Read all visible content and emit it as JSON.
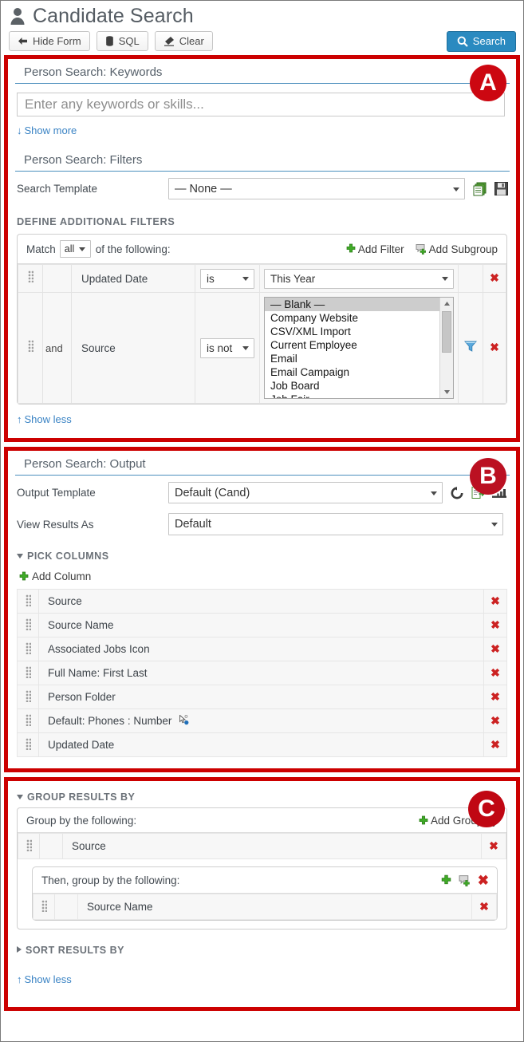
{
  "header": {
    "title": "Candidate Search",
    "person_icon": "person-icon",
    "buttons": {
      "hide_form": "Hide Form",
      "sql": "SQL",
      "clear": "Clear",
      "search": "Search"
    }
  },
  "annotations": {
    "a": "A",
    "b": "B",
    "c": "C"
  },
  "keywords": {
    "section_title": "Person Search: Keywords",
    "input_value": "",
    "input_placeholder": "Enter any keywords or skills...",
    "show_more": "Show more",
    "show_more_arrow": "↓"
  },
  "filters": {
    "section_title": "Person Search: Filters",
    "search_template_label": "Search Template",
    "search_template_value": "— None —",
    "copy_icon": "copy-templates-icon",
    "save_icon": "save-template-icon",
    "define_heading": "DEFINE ADDITIONAL FILTERS",
    "match_prefix": "Match",
    "match_value": "all",
    "match_suffix": "of the following:",
    "add_filter": "Add Filter",
    "add_subgroup": "Add Subgroup",
    "rows": [
      {
        "conjunction": "",
        "field": "Updated Date",
        "operator": "is",
        "value_type": "select",
        "value": "This Year"
      },
      {
        "conjunction": "and",
        "field": "Source",
        "operator": "is not",
        "value_type": "listbox",
        "options": [
          "— Blank —",
          "Company Website",
          "CSV/XML Import",
          "Current Employee",
          "Email",
          "Email Campaign",
          "Job Board",
          "Job Fair"
        ],
        "selected_option": "— Blank —",
        "funnel_icon": "filter-funnel-icon"
      }
    ],
    "show_less": "Show less",
    "show_less_arrow": "↑"
  },
  "output": {
    "section_title": "Person Search: Output",
    "output_template_label": "Output Template",
    "output_template_value": "Default (Cand)",
    "reset_icon": "reset-icon",
    "export_icon": "export-template-icon",
    "chart_icon": "chart-icon",
    "view_results_label": "View Results As",
    "view_results_value": "Default",
    "pick_columns_heading": "PICK COLUMNS",
    "add_column": "Add Column",
    "columns": [
      {
        "name": "Source",
        "icon": ""
      },
      {
        "name": "Source Name",
        "icon": ""
      },
      {
        "name": "Associated Jobs Icon",
        "icon": ""
      },
      {
        "name": "Full Name: First Last",
        "icon": ""
      },
      {
        "name": "Person Folder",
        "icon": ""
      },
      {
        "name": "Default: Phones : Number",
        "icon": "cursor-pointer-icon"
      },
      {
        "name": "Updated Date",
        "icon": ""
      }
    ]
  },
  "group_results": {
    "heading": "GROUP RESULTS BY",
    "group_by_label": "Group by the following:",
    "add_group_by": "Add Group-by",
    "rows": [
      {
        "name": "Source"
      }
    ],
    "subgroup": {
      "label": "Then, group by the following:",
      "add_icon": "add-icon",
      "subgroup_icon": "add-subgroup-icon",
      "delete_icon": "delete-icon",
      "rows": [
        {
          "name": "Source Name"
        }
      ]
    }
  },
  "sort_results": {
    "heading": "SORT RESULTS BY"
  },
  "footer": {
    "show_less": "Show less",
    "show_less_arrow": "↑"
  },
  "colors": {
    "annotation_red": "#cc0000",
    "accent_blue": "#2a8ac0",
    "link_blue": "#3a83c4",
    "green": "#46a818",
    "delete_red": "#cc2222"
  }
}
